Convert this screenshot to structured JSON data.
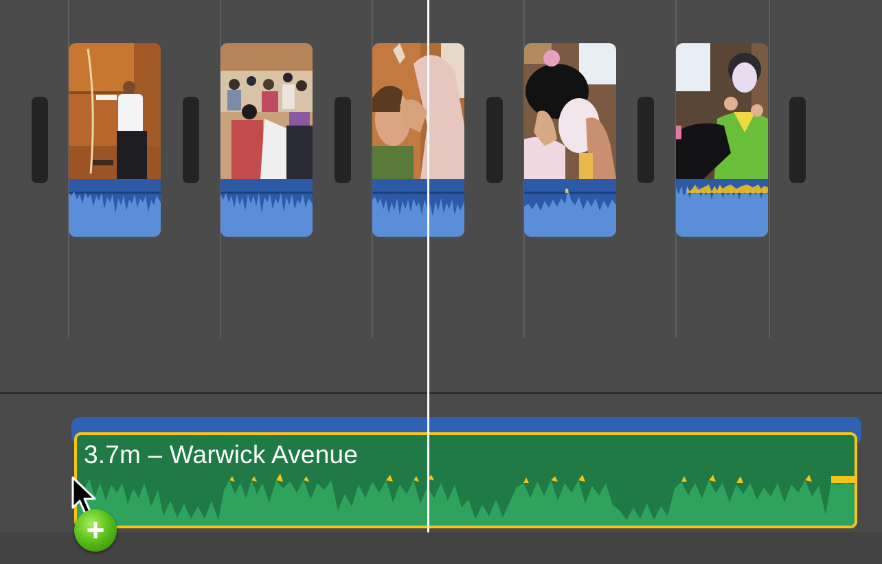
{
  "project_timeline": {
    "clips": [
      {
        "id": "clip-1",
        "subject": "archer in dojo"
      },
      {
        "id": "clip-2",
        "subject": "crowded hall"
      },
      {
        "id": "clip-3",
        "subject": "hair styling"
      },
      {
        "id": "clip-4",
        "subject": "makeup application"
      },
      {
        "id": "clip-5",
        "subject": "child in green costume"
      }
    ],
    "transition_count": 6
  },
  "music_track": {
    "title": "3.7m – Warwick Avenue"
  },
  "icons": {
    "cursor": "arrow-cursor-icon",
    "add": "plus-icon",
    "add_symbol": "+"
  },
  "colors": {
    "background": "#4b4b4b",
    "clip_audio": "#2c5aa6",
    "music_clip": "#1f7a45",
    "music_wave": "#2fa35e",
    "music_selection": "#f5c518",
    "playhead": "#ffffff"
  }
}
